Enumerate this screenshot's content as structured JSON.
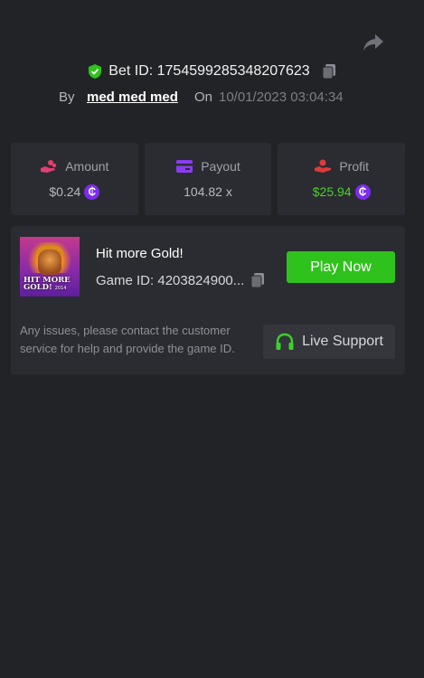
{
  "header": {
    "share_icon": "share-arrow-icon",
    "bet_id_label": "Bet ID: 1754599285348207623",
    "by_label": "By",
    "username": "med med med",
    "on_label": "On",
    "datetime": "10/01/2023 03:04:34",
    "verified_icon": "shield-check-icon",
    "copy_icon": "copy-icon"
  },
  "stats": [
    {
      "label": "Amount",
      "value": "$0.24",
      "icon": "hand-coins-icon",
      "color": "#e23f70",
      "coin": "₵"
    },
    {
      "label": "Payout",
      "value": "104.82 x",
      "icon": "card-icon",
      "color": "#8b3cf2"
    },
    {
      "label": "Profit",
      "value": "$25.94",
      "icon": "hand-coin-icon",
      "color": "#e03a3a",
      "coin": "₵",
      "value_color": "#4bd12a"
    }
  ],
  "game": {
    "thumbnail_art_text": "HIT MORE GOLD!",
    "thumbnail_art_small": "2014",
    "title": "Hit more Gold!",
    "game_id": "Game ID: 4203824900...",
    "play_label": "Play Now",
    "help_text": "Any issues, please contact the customer service for help and provide the game ID.",
    "support_label": "Live Support",
    "support_icon": "headphones-icon",
    "accent_green": "#2fc21c"
  }
}
